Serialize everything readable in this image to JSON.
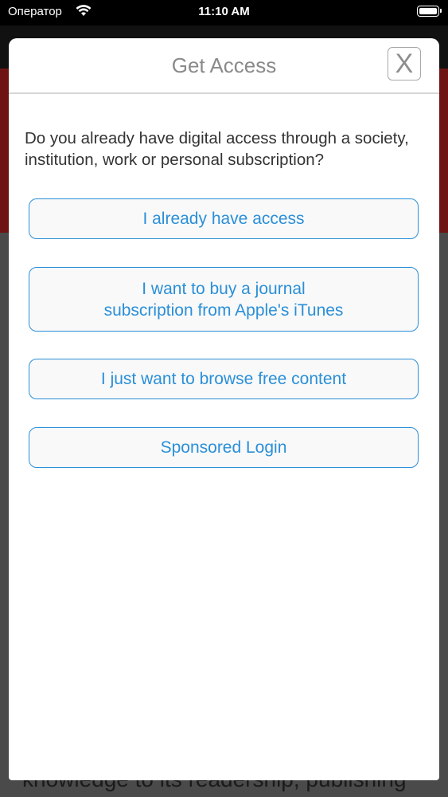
{
  "status_bar": {
    "carrier": "Оператор",
    "time": "11:10 AM"
  },
  "background": {
    "partial_text": "knowledge to its readership, publishing"
  },
  "modal": {
    "title": "Get Access",
    "close_label": "X",
    "question": "Do you already have digital access through a society, institution, work or personal subscription?",
    "options": [
      {
        "label": "I already have access"
      },
      {
        "label": "I want to buy a journal\nsubscription from Apple's iTunes"
      },
      {
        "label": "I just want to browse free content"
      },
      {
        "label": "Sponsored Login"
      }
    ]
  },
  "colors": {
    "accent": "#2a8fd8",
    "title_gray": "#8a8a8a",
    "background_red": "#6e1414"
  }
}
